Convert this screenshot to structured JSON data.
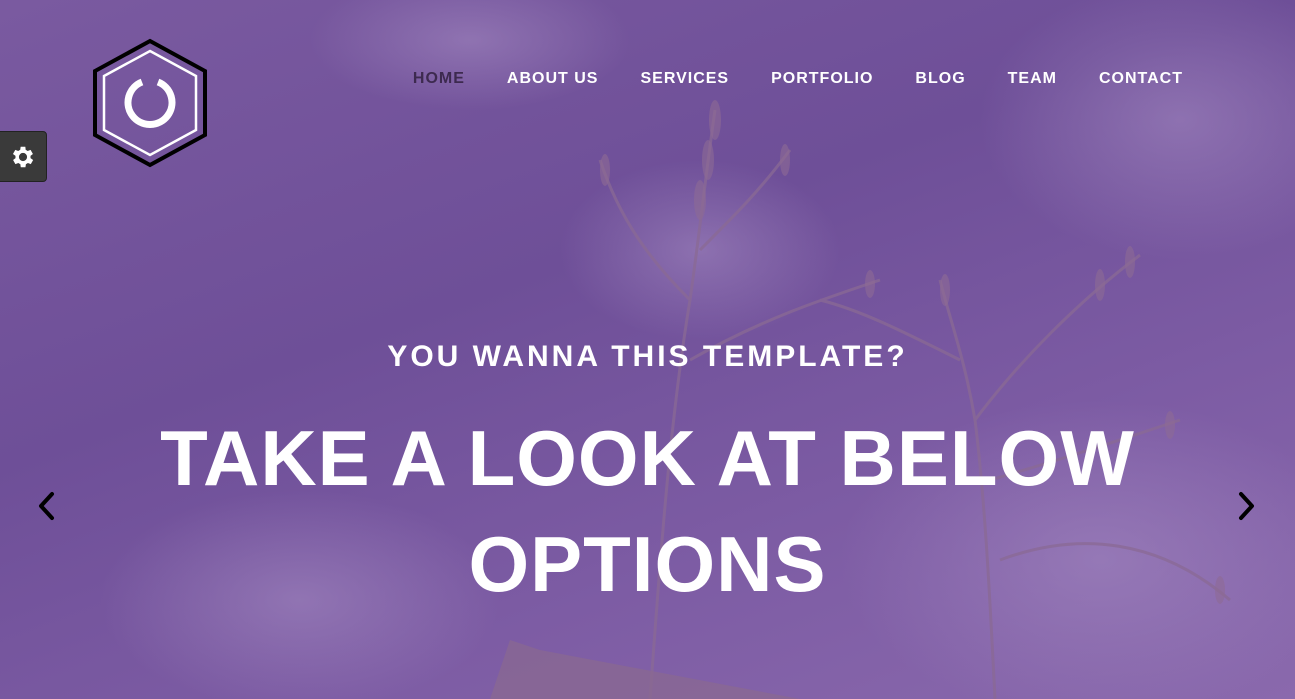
{
  "colors": {
    "overlay": "#6e4f98",
    "nav_text": "#ffffff",
    "nav_active": "#3d2a4f",
    "headline": "#ffffff",
    "gear_tab_bg": "#3a3a3a"
  },
  "logo": {
    "icon": "hexagon-power-logo-icon"
  },
  "nav": {
    "items": [
      {
        "label": "HOME",
        "active": true
      },
      {
        "label": "ABOUT US",
        "active": false
      },
      {
        "label": "SERVICES",
        "active": false
      },
      {
        "label": "PORTFOLIO",
        "active": false
      },
      {
        "label": "BLOG",
        "active": false
      },
      {
        "label": "TEAM",
        "active": false
      },
      {
        "label": "CONTACT",
        "active": false
      }
    ]
  },
  "settings_tab": {
    "icon": "gear-icon"
  },
  "hero": {
    "subtitle": "YOU WANNA THIS TEMPLATE?",
    "title_line1": "TAKE A LOOK AT BELOW",
    "title_line2": "OPTIONS"
  },
  "slider": {
    "prev_icon": "chevron-left-icon",
    "next_icon": "chevron-right-icon"
  }
}
